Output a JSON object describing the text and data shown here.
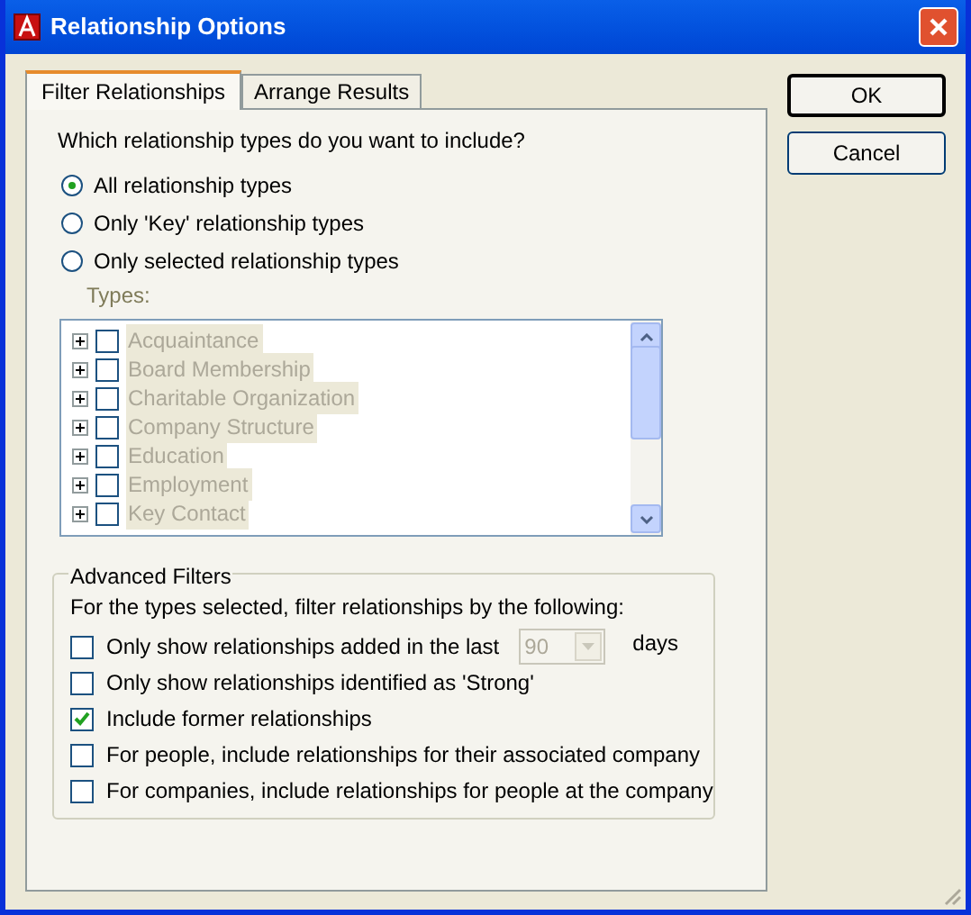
{
  "window": {
    "title": "Relationship Options"
  },
  "tabs": [
    {
      "label": "Filter Relationships",
      "selected": true
    },
    {
      "label": "Arrange Results",
      "selected": false
    }
  ],
  "prompt": "Which relationship types do you want to include?",
  "options": [
    {
      "label": "All relationship types",
      "selected": true
    },
    {
      "label": "Only 'Key' relationship types",
      "selected": false
    },
    {
      "label": "Only selected relationship types",
      "selected": false
    }
  ],
  "types": {
    "label": "Types:",
    "disabled": true,
    "items": [
      {
        "label": "Acquaintance",
        "checked": false
      },
      {
        "label": "Board Membership",
        "checked": false
      },
      {
        "label": "Charitable Organization",
        "checked": false
      },
      {
        "label": "Company Structure",
        "checked": false
      },
      {
        "label": "Education",
        "checked": false
      },
      {
        "label": "Employment",
        "checked": false
      },
      {
        "label": "Key Contact",
        "checked": false
      }
    ]
  },
  "advanced": {
    "title": "Advanced Filters",
    "description": "For the types selected, filter relationships by the following:",
    "filters": [
      {
        "kind": "combo",
        "label": "Only show relationships added in the last",
        "checked": false,
        "value": "90",
        "disabled": true,
        "suffix": "days"
      },
      {
        "kind": "plain",
        "label": "Only show relationships identified as 'Strong'",
        "checked": false
      },
      {
        "kind": "plain",
        "label": "Include former relationships",
        "checked": true
      },
      {
        "kind": "plain",
        "label": "For people, include relationships for their associated company",
        "checked": false
      },
      {
        "kind": "plain",
        "label": "For companies, include relationships for people at the company",
        "checked": false
      }
    ]
  },
  "buttons": [
    "OK",
    "Cancel"
  ]
}
